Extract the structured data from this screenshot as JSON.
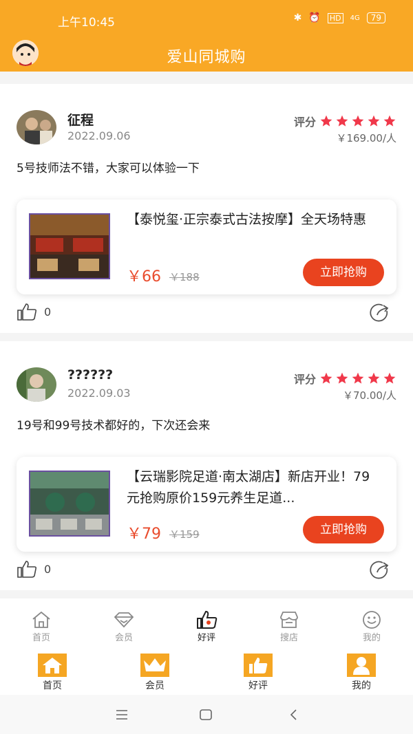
{
  "status": {
    "time": "上午10:45",
    "signal": "4G",
    "battery": "79"
  },
  "header": {
    "title": "爱山同城购"
  },
  "reviews": [
    {
      "name": "征程",
      "date": "2022.09.06",
      "score_label": "评分",
      "stars": 5,
      "price": "￥169.00/人",
      "text": "5号技师法不错，大家可以体验一下",
      "deal": {
        "title": "【泰悦玺·正宗泰式古法按摩】全天场特惠",
        "price": "￥66",
        "original_price": "￥188",
        "button": "立即抢购"
      },
      "likes": "0"
    },
    {
      "name": "??????",
      "date": "2022.09.03",
      "score_label": "评分",
      "stars": 5,
      "price": "￥70.00/人",
      "text": "19号和99号技术都好的，下次还会来",
      "deal": {
        "title": "【云瑞影院足道·南太湖店】新店开业！79元抢购原价159元养生足道...",
        "price": "￥79",
        "original_price": "￥159",
        "button": "立即抢购"
      },
      "likes": "0"
    }
  ],
  "tabbar": {
    "items": [
      {
        "label": "首页",
        "icon": "home-outline-icon"
      },
      {
        "label": "会员",
        "icon": "diamond-icon"
      },
      {
        "label": "好评",
        "icon": "thumbs-up-icon"
      },
      {
        "label": "搜店",
        "icon": "store-icon"
      },
      {
        "label": "我的",
        "icon": "smile-icon"
      }
    ],
    "active": "好评"
  },
  "tabbar2": {
    "items": [
      {
        "label": "首页",
        "icon": "home-filled-icon"
      },
      {
        "label": "会员",
        "icon": "crown-icon"
      },
      {
        "label": "好评",
        "icon": "thumbs-up-filled-icon"
      },
      {
        "label": "我的",
        "icon": "user-filled-icon"
      }
    ]
  },
  "colors": {
    "brand": "#f9a825",
    "price": "#e94c2d",
    "button": "#e9431f",
    "star": "#f0384a"
  }
}
